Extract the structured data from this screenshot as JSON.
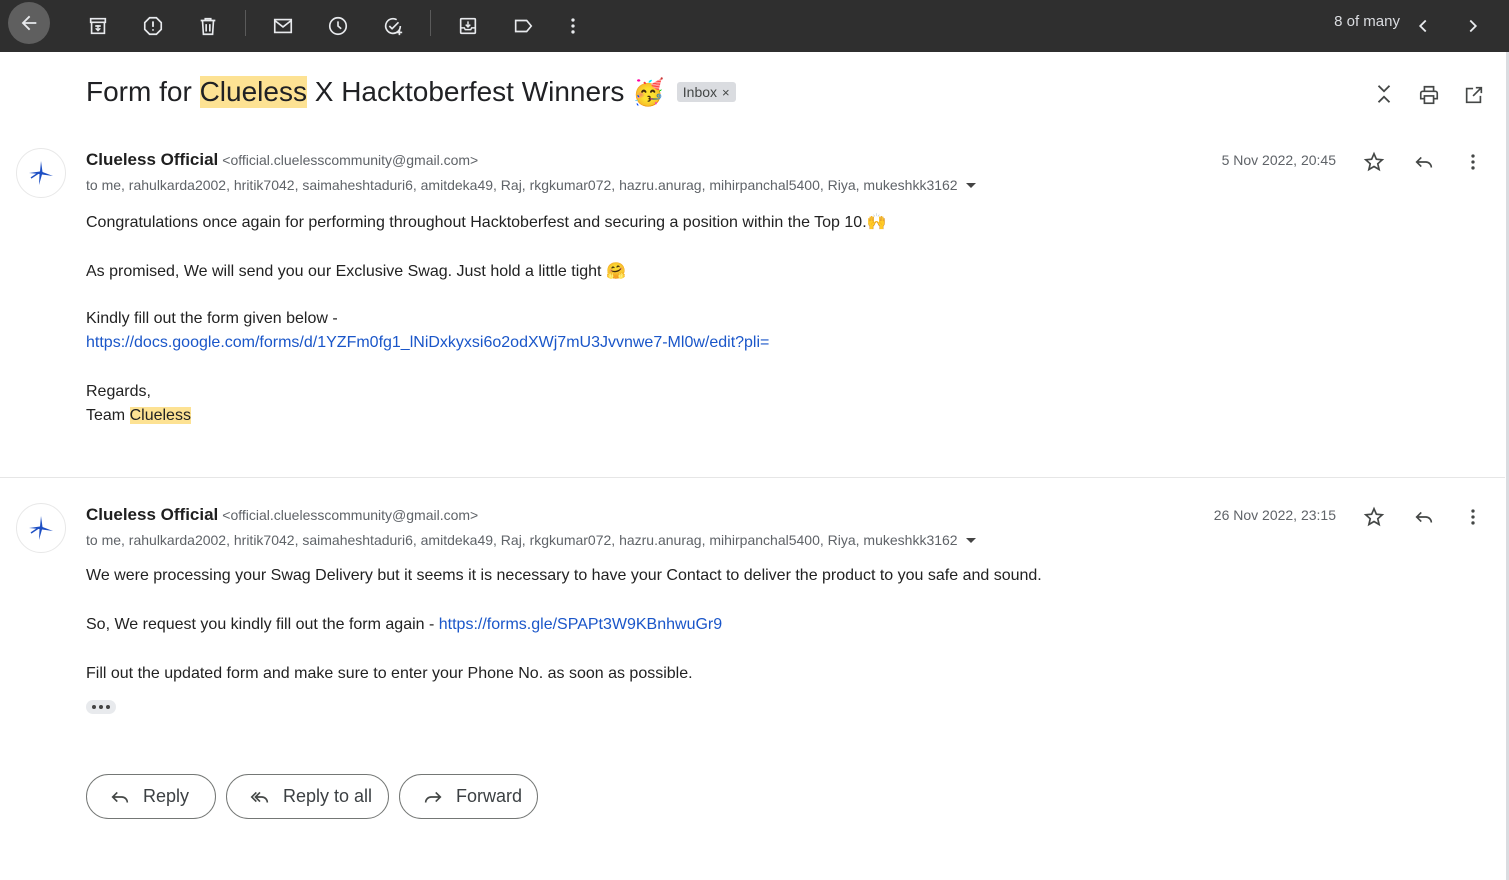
{
  "toolbar": {
    "buttons": [
      "back-icon",
      "archive-icon",
      "report-spam-icon",
      "delete-icon",
      "mark-unread-icon",
      "snooze-icon",
      "add-task-icon",
      "move-to-icon",
      "label-icon",
      "more-icon"
    ],
    "count_text": "8 of many"
  },
  "subject": {
    "prefix": "Form for ",
    "highlight": "Clueless",
    "suffix": " X Hacktoberfest Winners",
    "emoji": "🥳",
    "label_chip": "Inbox",
    "chip_close": "×"
  },
  "messages": [
    {
      "sender_name": "Clueless Official",
      "sender_email": "<official.cluelesscommunity@gmail.com>",
      "recipients": "to me, rahulkarda2002, hritik7042, saimaheshtaduri6, amitdeka49, Raj, rkgkumar072, hazru.anurag, mihirpanchal5400, Riya, mukeshkk3162",
      "date": "5 Nov 2022, 20:45",
      "body": {
        "line1": "Congratulations once again for performing throughout Hacktoberfest and securing a position within the Top 10.🙌",
        "line2": "As promised, We will send you our Exclusive Swag. Just hold a little tight 🤗",
        "line3": "Kindly fill out the form given below -",
        "link": "https://docs.google.com/forms/d/1YZFm0fg1_lNiDxkyxsi6o2odXWj7mU3Jvvnwe7-Ml0w/edit?pli=",
        "regards": "Regards,",
        "team_prefix": "Team ",
        "team_highlight": "Clueless"
      }
    },
    {
      "sender_name": "Clueless Official",
      "sender_email": "<official.cluelesscommunity@gmail.com>",
      "recipients": "to me, rahulkarda2002, hritik7042, saimaheshtaduri6, amitdeka49, Raj, rkgkumar072, hazru.anurag, mihirpanchal5400, Riya, mukeshkk3162",
      "date": "26 Nov 2022, 23:15",
      "body": {
        "line1": "We were processing your Swag Delivery but it seems it is necessary to have your Contact to deliver the product to you safe and sound.",
        "line2_prefix": "So, We request you kindly fill out the form again - ",
        "line2_link": "https://forms.gle/SPAPt3W9KBnhwuGr9",
        "line3": "Fill out the updated form and make sure to enter your Phone No. as soon as possible."
      }
    }
  ],
  "actions": {
    "reply": "Reply",
    "reply_all": "Reply to all",
    "forward": "Forward"
  },
  "colors": {
    "toolbar_bg": "#2f2f2f",
    "highlight": "#fde293",
    "link": "#1a56c9",
    "avatar_logo": "#1d4fc4"
  }
}
